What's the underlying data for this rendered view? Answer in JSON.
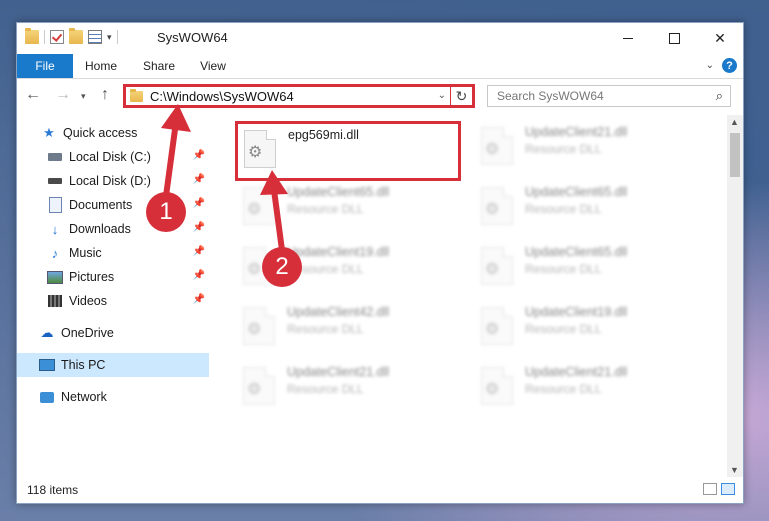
{
  "window": {
    "title": "SysWOW64",
    "controls": {
      "minimize": "",
      "maximize": "",
      "close": "✕"
    }
  },
  "ribbon": {
    "tabs": [
      "File",
      "Home",
      "Share",
      "View"
    ],
    "help": "?"
  },
  "navbar": {
    "address": "C:\\Windows\\SysWOW64",
    "search_placeholder": "Search SysWOW64"
  },
  "sidebar": {
    "items": [
      {
        "label": "Quick access",
        "icon": "star-icon"
      },
      {
        "label": "Local Disk (C:)",
        "icon": "disk-icon",
        "pinned": true
      },
      {
        "label": "Local Disk (D:)",
        "icon": "disk-icon",
        "pinned": true
      },
      {
        "label": "Documents",
        "icon": "document-icon",
        "pinned": true
      },
      {
        "label": "Downloads",
        "icon": "download-icon",
        "pinned": true
      },
      {
        "label": "Music",
        "icon": "music-icon",
        "pinned": true
      },
      {
        "label": "Pictures",
        "icon": "pictures-icon",
        "pinned": true
      },
      {
        "label": "Videos",
        "icon": "videos-icon",
        "pinned": true
      },
      {
        "label": "OneDrive",
        "icon": "cloud-icon"
      },
      {
        "label": "This PC",
        "icon": "computer-icon",
        "selected": true
      },
      {
        "label": "Network",
        "icon": "network-icon"
      }
    ]
  },
  "files": [
    {
      "name": "epg569mi.dll",
      "type": ""
    },
    {
      "name": "UpdateClient21.dll",
      "type": "Resource DLL"
    },
    {
      "name": "UpdateClient65.dll",
      "type": "Resource DLL"
    },
    {
      "name": "UpdateClient65.dll",
      "type": "Resource DLL"
    },
    {
      "name": "UpdateClient19.dll",
      "type": "Resource DLL"
    },
    {
      "name": "UpdateClient65.dll",
      "type": "Resource DLL"
    },
    {
      "name": "UpdateClient42.dll",
      "type": "Resource DLL"
    },
    {
      "name": "UpdateClient19.dll",
      "type": "Resource DLL"
    },
    {
      "name": "UpdateClient21.dll",
      "type": "Resource DLL"
    },
    {
      "name": "UpdateClient21.dll",
      "type": "Resource DLL"
    }
  ],
  "status": {
    "item_count": "118 items"
  },
  "annotations": {
    "step1": "1",
    "step2": "2",
    "color": "#d62f3a"
  },
  "colors": {
    "accent": "#1979ca",
    "highlight": "#d62f3a",
    "selected_bg": "#cce8ff"
  }
}
